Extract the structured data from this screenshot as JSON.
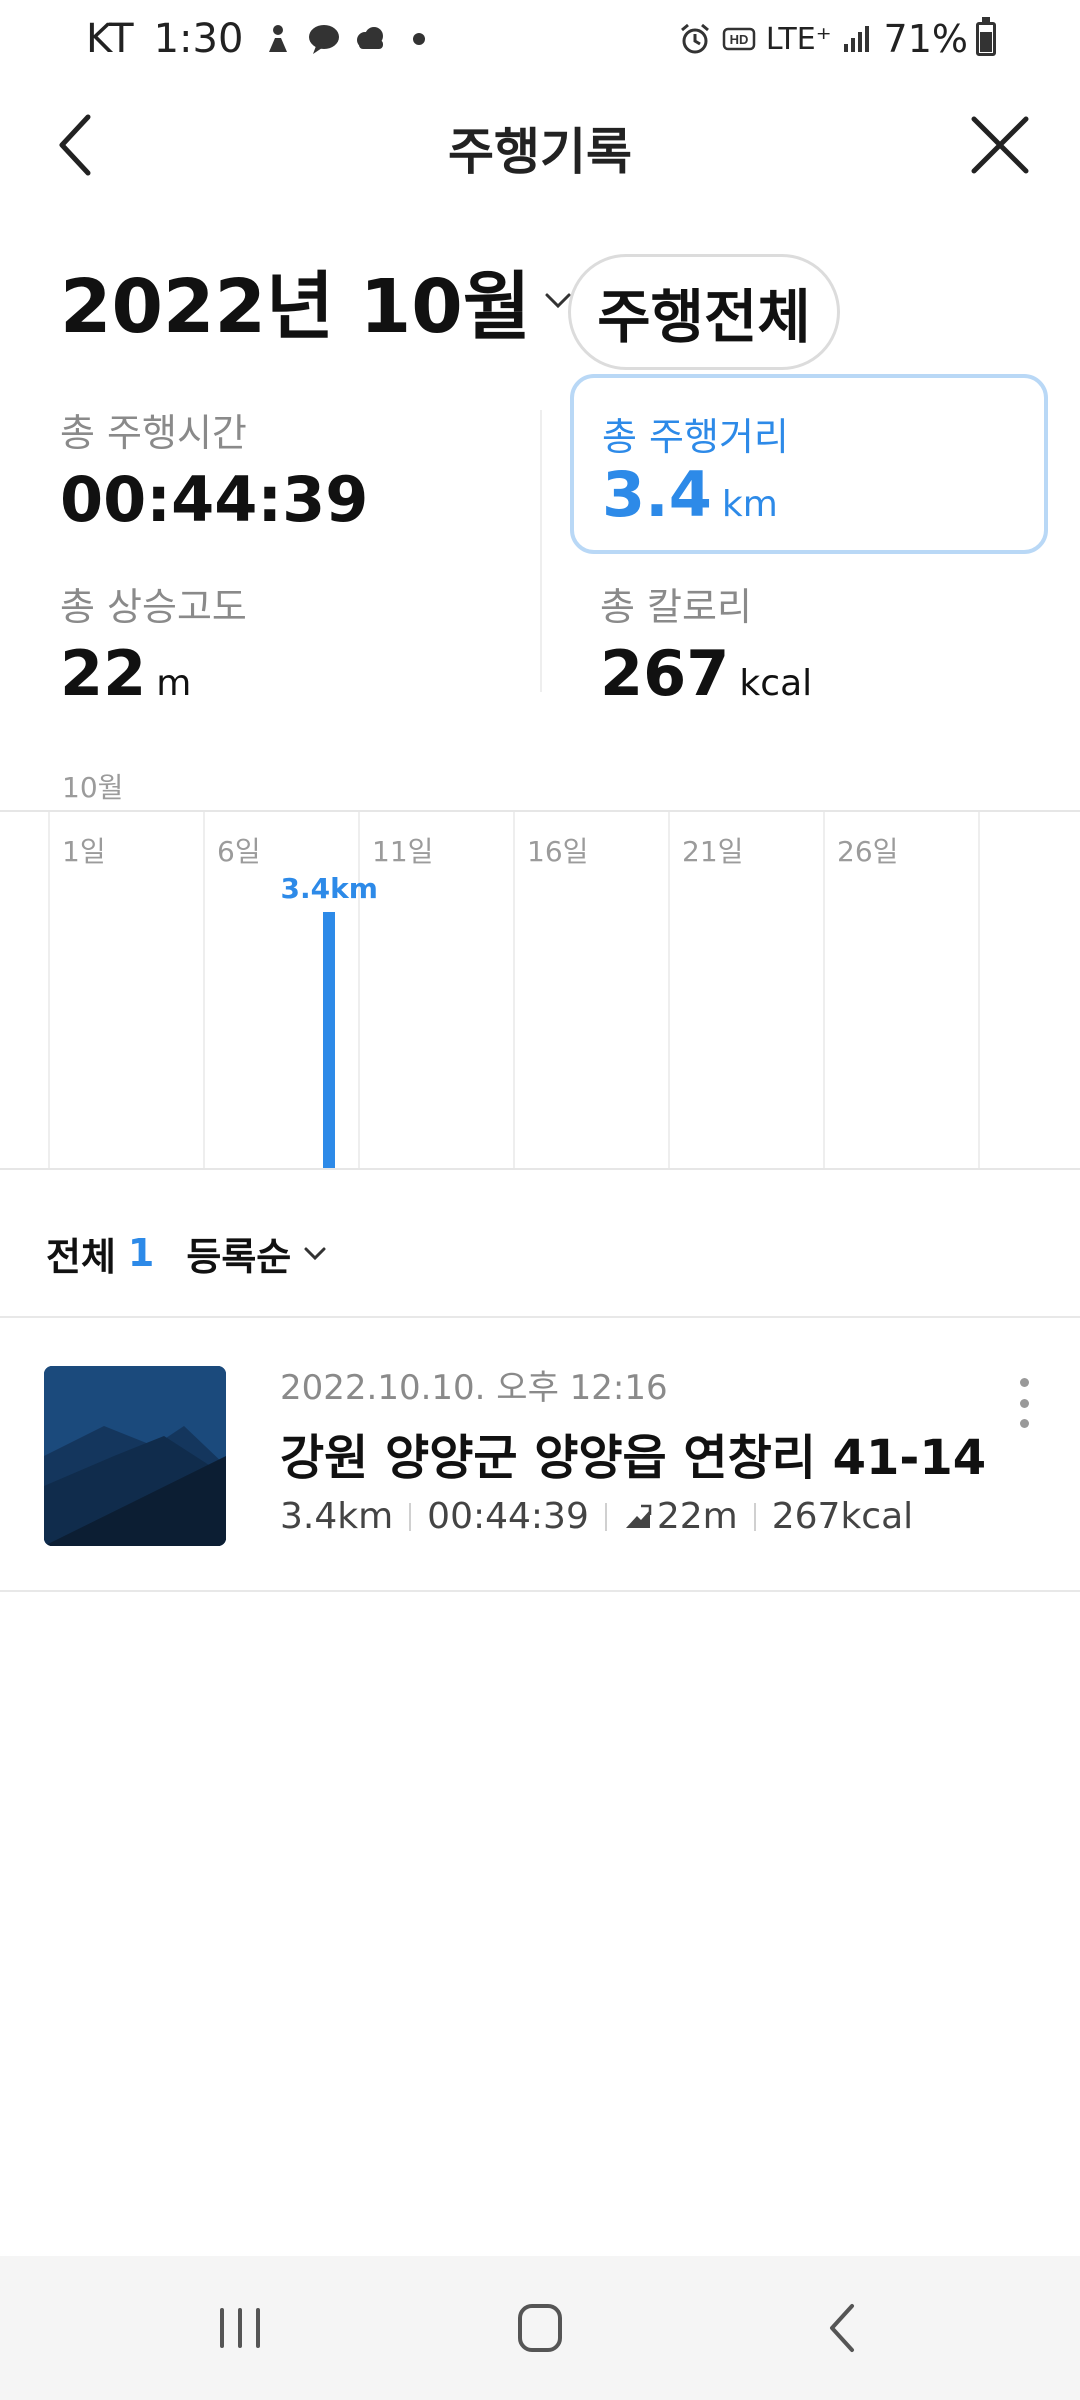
{
  "status_bar": {
    "carrier": "KT",
    "time": "1:30",
    "network": "LTE⁺",
    "battery": "71%",
    "left_icons": [
      "person-icon",
      "talk-icon",
      "cloud-icon"
    ],
    "right_icons": [
      "alarm-icon",
      "hd-voice-icon",
      "signal-icon",
      "battery-icon"
    ]
  },
  "header": {
    "title": "주행기록"
  },
  "period": {
    "month": "2022년 10월",
    "filter": "주행전체"
  },
  "stats": {
    "time_label": "총 주행시간",
    "time_value": "00:44:39",
    "distance_label": "총 주행거리",
    "distance_value": "3.4",
    "distance_unit": "km",
    "elevation_label": "총 상승고도",
    "elevation_value": "22",
    "elevation_unit": "m",
    "calorie_label": "총 칼로리",
    "calorie_value": "267",
    "calorie_unit": "kcal"
  },
  "chart_data": {
    "type": "bar",
    "title": "10월",
    "x_ticks": [
      "1일",
      "6일",
      "11일",
      "16일",
      "21일",
      "26일"
    ],
    "x_tick_days": [
      1,
      6,
      11,
      16,
      21,
      26
    ],
    "x_range": [
      1,
      31
    ],
    "bars": [
      {
        "day": 10,
        "value": 3.4,
        "label": "3.4km"
      }
    ],
    "ylabel": "",
    "unit": "km",
    "ylim": [
      0,
      3.4
    ],
    "color": "#2d8ae8"
  },
  "list": {
    "total_label": "전체",
    "total_count": "1",
    "sort_label": "등록순"
  },
  "records": [
    {
      "date": "2022.10.10. 오후 12:16",
      "title": "강원 양양군 양양읍 연창리 41-14",
      "distance": "3.4km",
      "duration": "00:44:39",
      "elevation": "22m",
      "calories": "267kcal"
    }
  ],
  "colors": {
    "accent": "#2d8ae8",
    "selected_border": "#b9d8f6"
  }
}
